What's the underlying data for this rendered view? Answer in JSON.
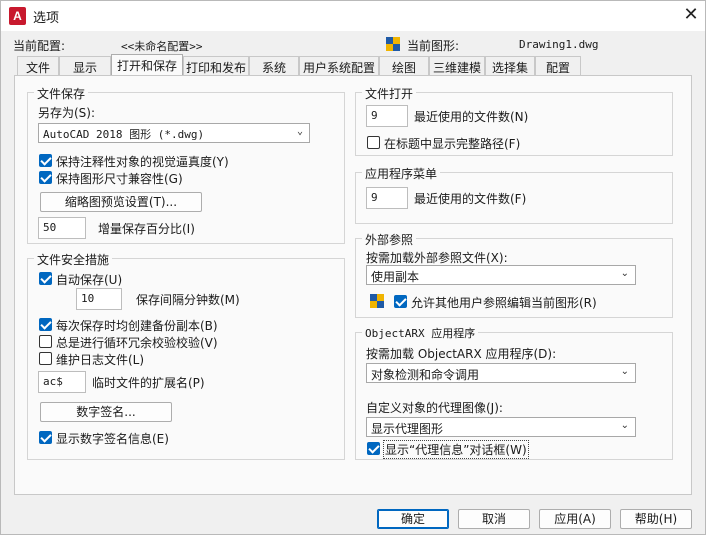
{
  "window": {
    "title": "选项",
    "close_glyph": "✕",
    "app_icon": "A"
  },
  "header": {
    "profile_label": "当前配置:",
    "profile_value": "<<未命名配置>>",
    "drawing_label": "当前图形:",
    "drawing_value": "Drawing1.dwg"
  },
  "tabs": [
    "文件",
    "显示",
    "打开和保存",
    "打印和发布",
    "系统",
    "用户系统配置",
    "绘图",
    "三维建模",
    "选择集",
    "配置"
  ],
  "active_tab": "打开和保存",
  "file_save": {
    "title": "文件保存",
    "save_as_label": "另存为(S):",
    "save_as_value": "AutoCAD 2018 图形 (*.dwg)",
    "check_annotative": "保持注释性对象的视觉逼真度(Y)",
    "check_annotative_on": true,
    "check_size_compat": "保持图形尺寸兼容性(G)",
    "check_size_compat_on": true,
    "thumbnail_button": "缩略图预览设置(T)...",
    "incremental_value": "50",
    "incremental_label": "增量保存百分比(I)"
  },
  "file_safety": {
    "title": "文件安全措施",
    "autosave_label": "自动保存(U)",
    "autosave_on": true,
    "interval_value": "10",
    "interval_label": "保存间隔分钟数(M)",
    "backup_label": "每次保存时均创建备份副本(B)",
    "backup_on": true,
    "crc_label": "总是进行循环冗余校验校验(V)",
    "crc_on": false,
    "log_label": "维护日志文件(L)",
    "log_on": false,
    "temp_ext_value": "ac$",
    "temp_ext_label": "临时文件的扩展名(P)",
    "digital_sig_button": "数字签名...",
    "show_sig_label": "显示数字签名信息(E)",
    "show_sig_on": true
  },
  "file_open": {
    "title": "文件打开",
    "recent_value": "9",
    "recent_label": "最近使用的文件数(N)",
    "full_path_label": "在标题中显示完整路径(F)",
    "full_path_on": false
  },
  "app_menu": {
    "title": "应用程序菜单",
    "recent_value": "9",
    "recent_label": "最近使用的文件数(F)"
  },
  "xref": {
    "title": "外部参照",
    "demand_label": "按需加载外部参照文件(X):",
    "demand_value": "使用副本",
    "allow_edit_label": "允许其他用户参照编辑当前图形(R)",
    "allow_edit_on": true
  },
  "objectarx": {
    "title": "ObjectARX 应用程序",
    "demand_label": "按需加载 ObjectARX 应用程序(D):",
    "demand_value": "对象检测和命令调用",
    "proxy_label": "自定义对象的代理图像(J):",
    "proxy_value": "显示代理图形",
    "proxy_dialog_label": "显示“代理信息”对话框(W)",
    "proxy_dialog_on": true
  },
  "footer": {
    "ok": "确定",
    "cancel": "取消",
    "apply": "应用(A)",
    "help": "帮助(H)"
  },
  "colors": {
    "accent": "#0067c0",
    "app_icon": "#c8192e"
  }
}
